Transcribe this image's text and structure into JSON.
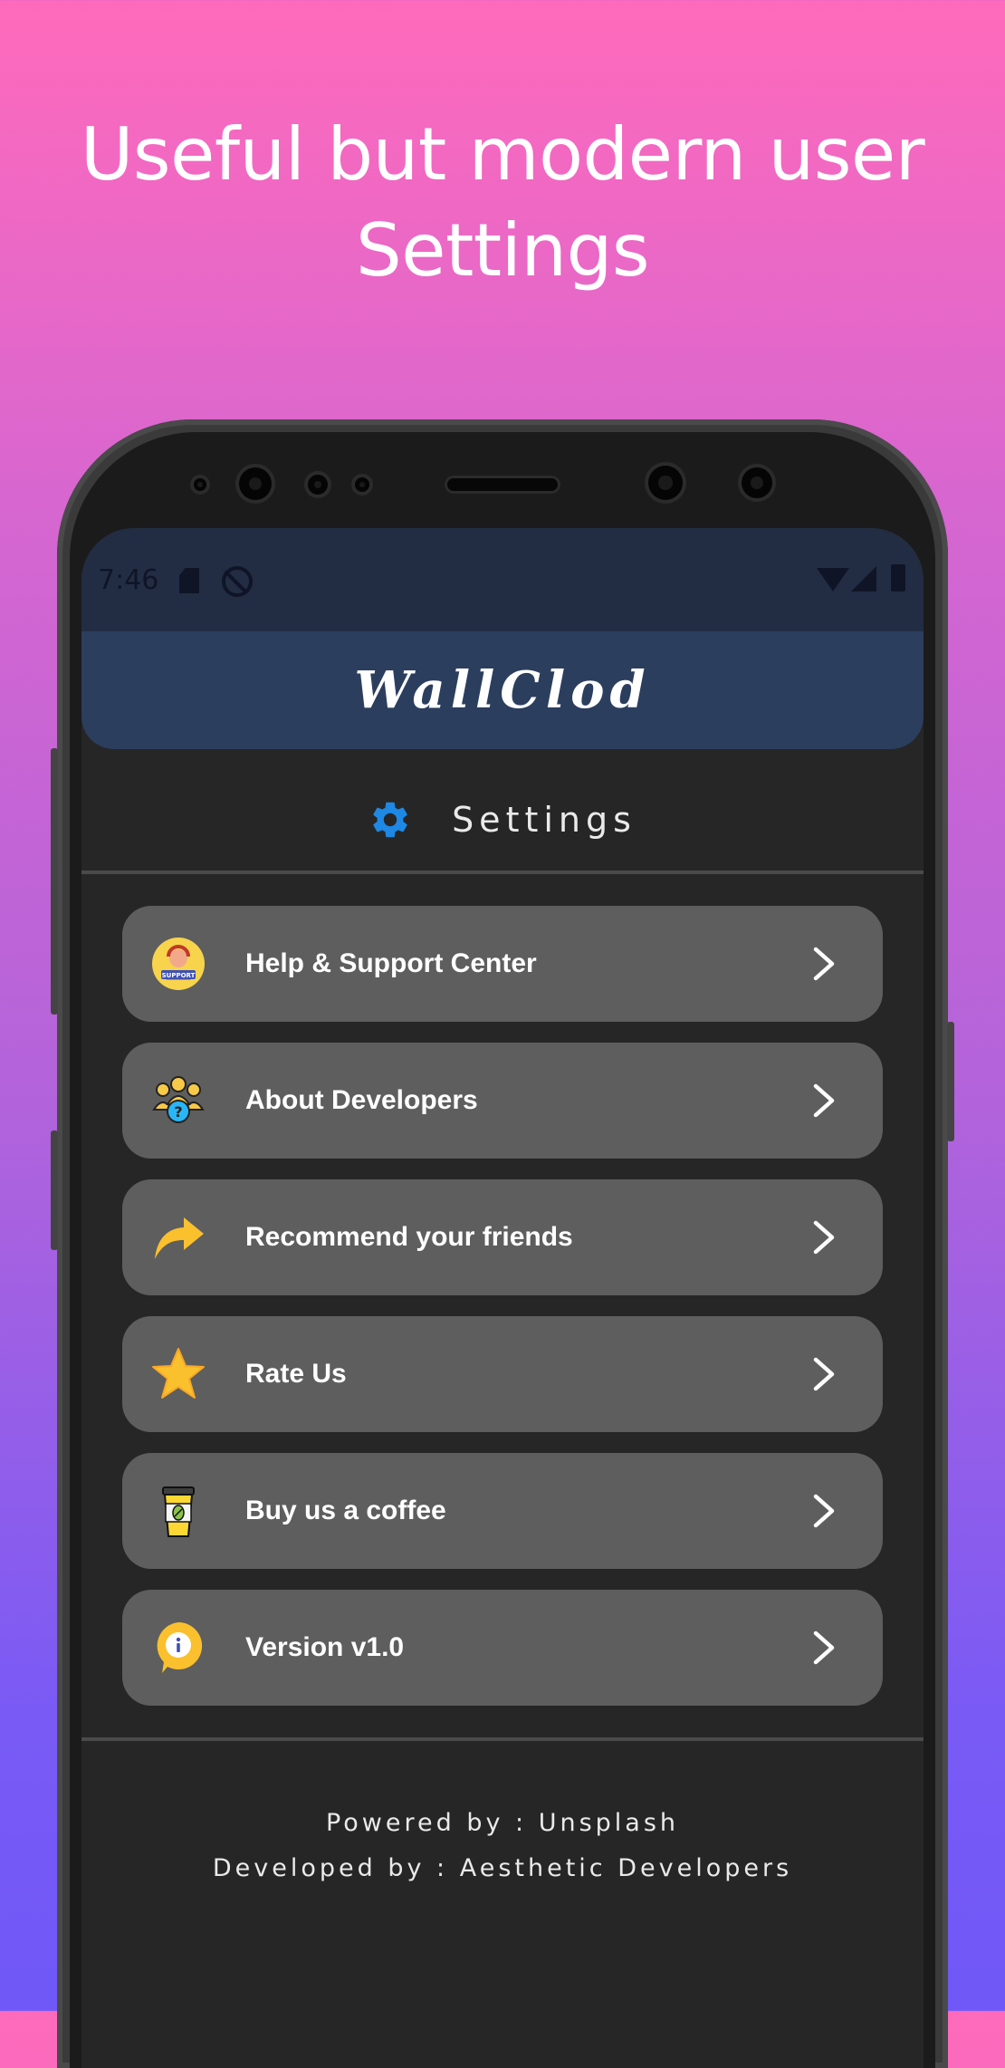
{
  "headline": {
    "line1": "Useful but modern user",
    "line2": "Settings"
  },
  "status_bar": {
    "time": "7:46"
  },
  "app_bar": {
    "title": "WallClod"
  },
  "settings": {
    "title": "Settings",
    "icon": "gear-icon",
    "accent": "#1e88e5"
  },
  "menu": {
    "items": [
      {
        "label": "Help & Support Center",
        "icon": "support-agent-icon"
      },
      {
        "label": "About Developers",
        "icon": "developers-group-icon"
      },
      {
        "label": "Recommend your friends",
        "icon": "share-arrow-icon"
      },
      {
        "label": "Rate Us",
        "icon": "star-icon"
      },
      {
        "label": "Buy us a coffee",
        "icon": "coffee-cup-icon"
      },
      {
        "label": "Version v1.0",
        "icon": "info-icon"
      }
    ]
  },
  "footer": {
    "powered_by": "Powered by : Unsplash",
    "developed_by": "Developed by : Aesthetic Developers"
  },
  "colors": {
    "screen_bg": "#262626",
    "status_bar_bg": "#222d44",
    "app_bar_bg": "#2c3e5e",
    "item_bg": "#5e5e5e",
    "gradient_top": "#ff6abb",
    "gradient_bottom": "#6f58f7"
  }
}
